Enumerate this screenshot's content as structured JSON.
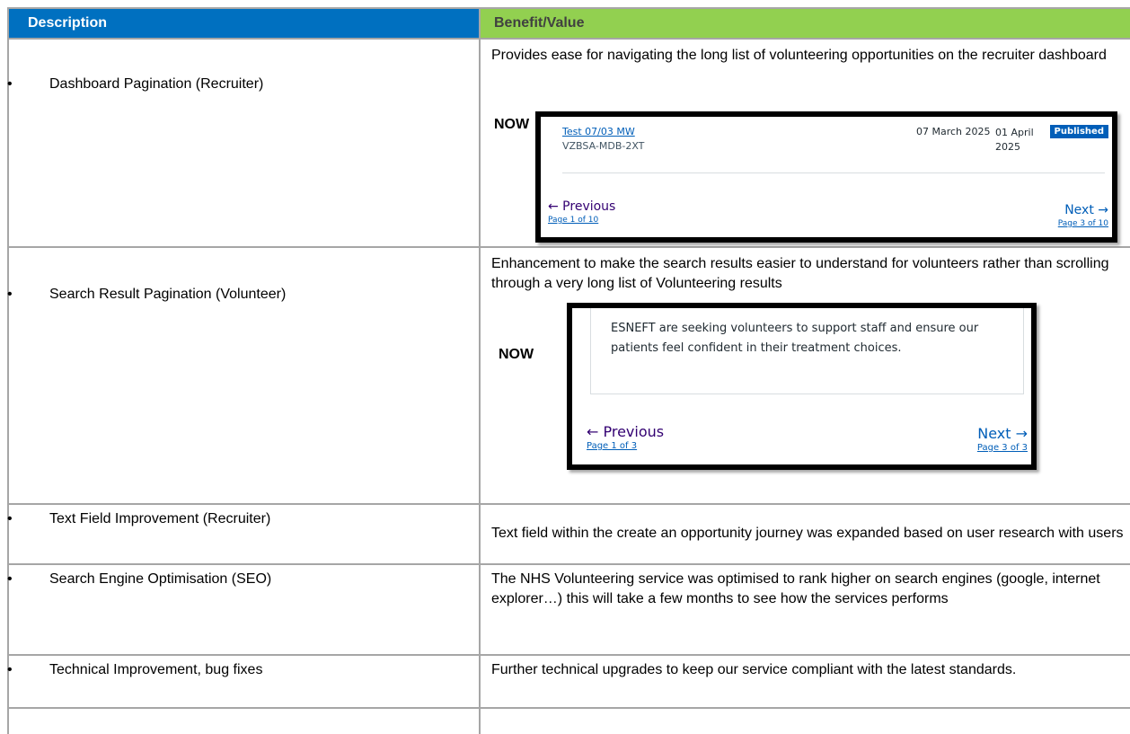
{
  "header": {
    "description": "Description",
    "benefit": "Benefit/Value"
  },
  "rows": [
    {
      "bullet": "•",
      "description": "Dashboard Pagination (Recruiter)",
      "benefit": "Provides ease for navigating the long list of volunteering opportunities on the recruiter dashboard",
      "now_label": "NOW",
      "screenshot": {
        "opportunity_link": "Test 07/03 MW",
        "reference": "VZBSA-MDB-2XT",
        "start_date": "07 March 2025",
        "end_date": "01 April 2025",
        "count": "1",
        "status_badge": "Published",
        "previous_label": "← Previous",
        "previous_page": "Page 1 of 10",
        "next_label": "Next →",
        "next_page": "Page 3 of 10"
      }
    },
    {
      "bullet": "•",
      "description": "Search Result Pagination (Volunteer)",
      "benefit": "Enhancement to make the search results easier to understand for volunteers rather than scrolling through a very long list of Volunteering results",
      "now_label": "NOW",
      "screenshot": {
        "card_text": "ESNEFT are seeking volunteers to support staff and ensure our patients feel confident in their treatment choices.",
        "previous_label": "← Previous",
        "previous_page": "Page 1 of 3",
        "next_label": "Next →",
        "next_page": "Page 3 of 3"
      }
    },
    {
      "bullet": "•",
      "description": "Text Field Improvement (Recruiter)",
      "benefit": "Text field within the create an opportunity journey was expanded based on user research with users"
    },
    {
      "bullet": "•",
      "description": "Search Engine Optimisation (SEO)",
      "benefit": "The NHS Volunteering service was optimised to rank higher on search engines (google, internet explorer…) this will take a few months to see how the services performs"
    },
    {
      "bullet": "•",
      "description": "Technical Improvement, bug fixes",
      "benefit": "Further technical upgrades to keep our service compliant with the latest standards."
    }
  ],
  "colors": {
    "description_header_bg": "#0070c0",
    "benefit_header_bg": "#92d050",
    "grid": "#a6a6a6",
    "nhs_blue": "#005eb8",
    "nhs_purple": "#330072"
  }
}
